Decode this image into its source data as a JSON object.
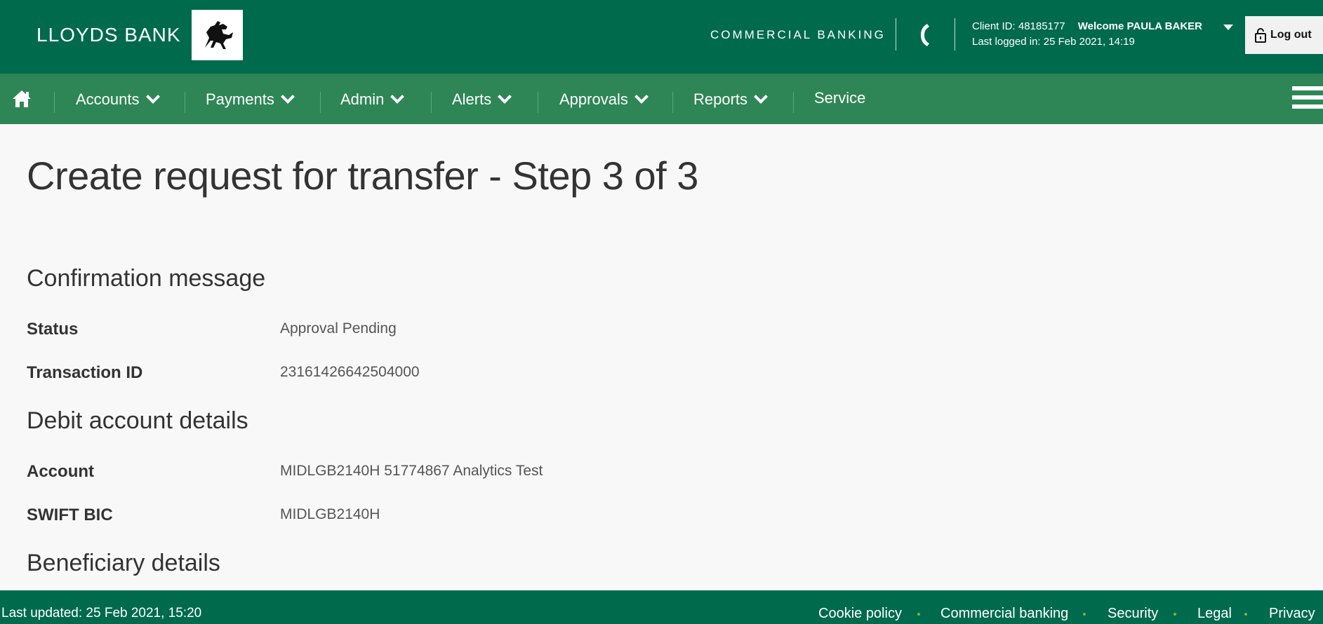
{
  "header": {
    "brand_name": "LLOYDS BANK",
    "logo_icon": "black-horse-logo",
    "section_label": "COMMERCIAL BANKING",
    "phone_icon": "phone-icon",
    "client_id": "Client ID: 48185177",
    "welcome": "Welcome PAULA BAKER",
    "last_logged": "Last logged in: 25 Feb 2021, 14:19",
    "logout_label": "Log out",
    "colors": {
      "primary": "#006a4d",
      "nav": "#2e8656"
    }
  },
  "nav": {
    "home_icon": "home-icon",
    "items": [
      {
        "label": "Accounts"
      },
      {
        "label": "Payments"
      },
      {
        "label": "Admin"
      },
      {
        "label": "Alerts"
      },
      {
        "label": "Approvals"
      },
      {
        "label": "Reports"
      },
      {
        "label": "Service"
      }
    ],
    "menu_icon": "hamburger-menu-icon"
  },
  "main": {
    "title": "Create request for transfer - Step 3 of 3",
    "confirmation": {
      "heading": "Confirmation message",
      "status_label": "Status",
      "status_value": "Approval Pending",
      "txn_label": "Transaction ID",
      "txn_value": "23161426642504000"
    },
    "debit": {
      "heading": "Debit account details",
      "account_label": "Account",
      "account_value": "MIDLGB2140H 51774867 Analytics Test",
      "swift_label": "SWIFT BIC",
      "swift_value": "MIDLGB2140H"
    },
    "beneficiary": {
      "heading": "Beneficiary details"
    }
  },
  "footer": {
    "last_updated": "Last updated: 25 Feb 2021, 15:20",
    "links": [
      {
        "label": "Cookie policy"
      },
      {
        "label": "Commercial banking"
      },
      {
        "label": "Security"
      },
      {
        "label": "Legal"
      },
      {
        "label": "Privacy"
      }
    ]
  }
}
